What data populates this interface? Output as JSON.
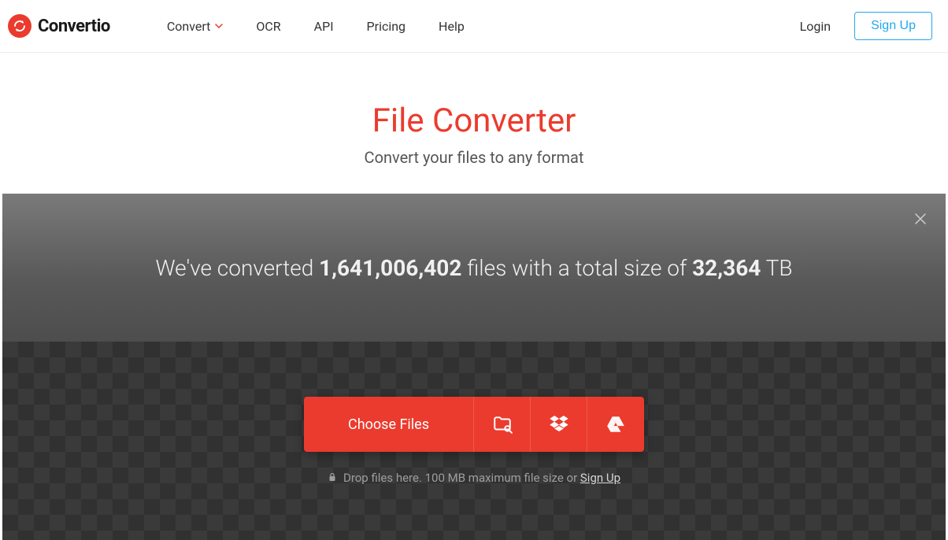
{
  "brand": {
    "name": "Convertio"
  },
  "nav": {
    "convert": "Convert",
    "ocr": "OCR",
    "api": "API",
    "pricing": "Pricing",
    "help": "Help"
  },
  "auth": {
    "login": "Login",
    "signup": "Sign Up"
  },
  "hero": {
    "title": "File Converter",
    "subtitle": "Convert your files to any format"
  },
  "stats": {
    "prefix": "We've converted ",
    "files_count": "1,641,006,402",
    "middle": " files with a total size of ",
    "total_size": "32,364",
    "size_unit": " TB"
  },
  "upload": {
    "choose_label": "Choose Files",
    "drop_prefix": "Drop files here. ",
    "max_size": "100 MB",
    "drop_middle": " maximum file size or ",
    "signup_link": "Sign Up"
  },
  "colors": {
    "accent": "#eb3b2e",
    "link_blue": "#22a7f0"
  }
}
